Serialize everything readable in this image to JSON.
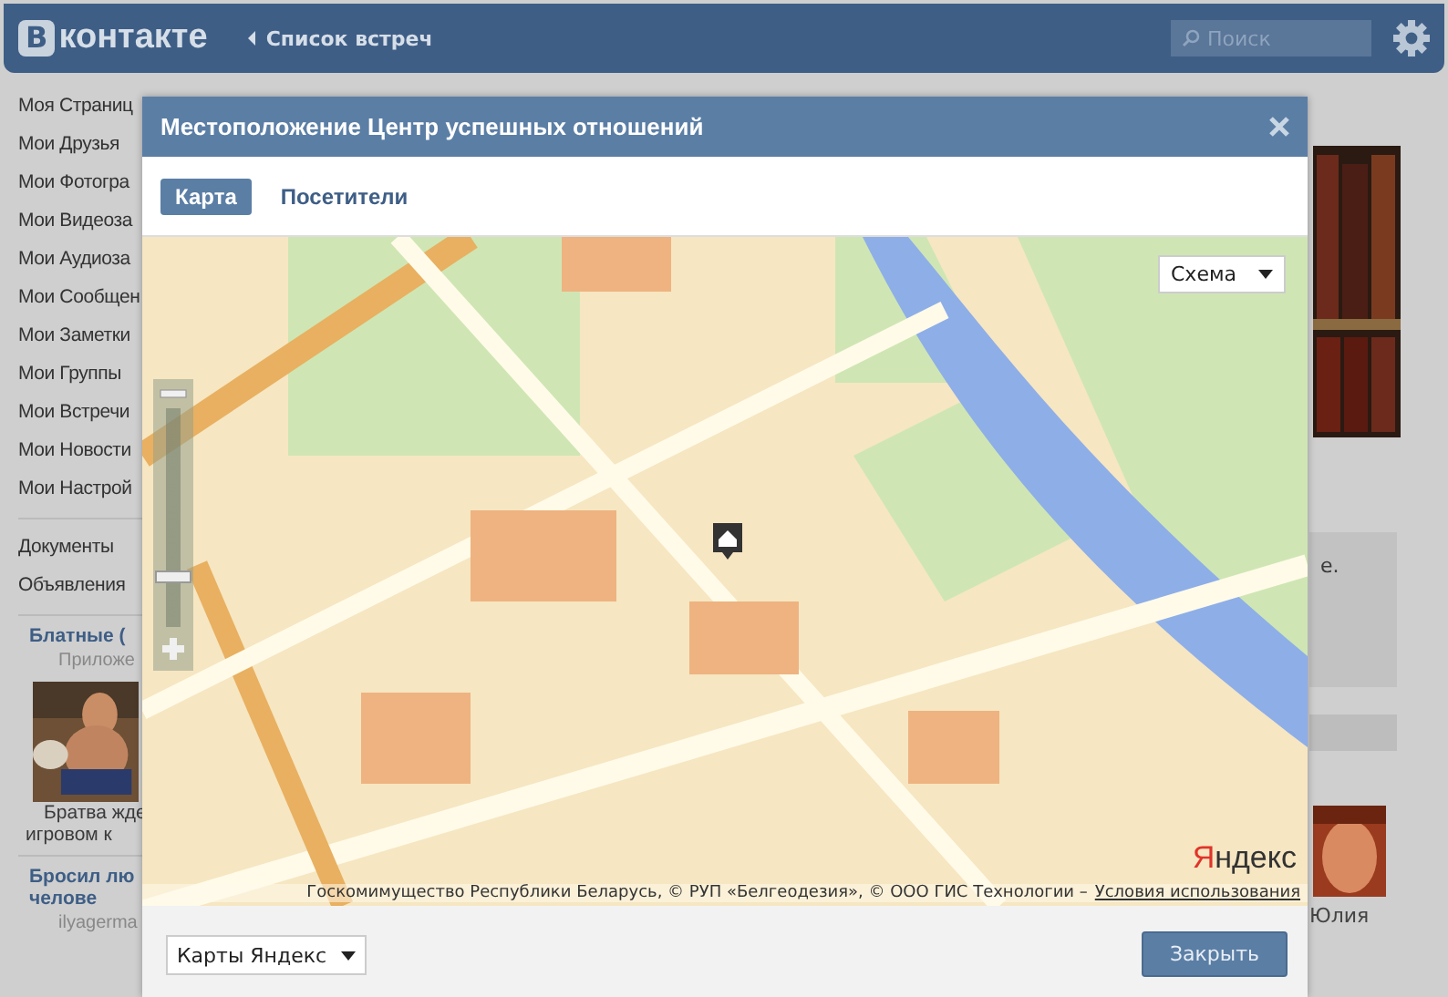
{
  "header": {
    "logo_letter": "В",
    "logo_text": "контакте",
    "back_link": "Список встреч",
    "search": {
      "placeholder": "Поиск"
    }
  },
  "sidebar": {
    "items": [
      "Моя Страниц",
      "Мои Друзья",
      "Мои Фотогра",
      "Мои Видеоза",
      "Мои Аудиоза",
      "Мои Сообщен",
      "Мои Заметки",
      "Мои Группы",
      "Мои Встречи",
      "Мои Новости",
      "Мои Настрой"
    ],
    "extra_items": [
      "Документы",
      "Объявления"
    ]
  },
  "ads": [
    {
      "title": [
        "Блатные ("
      ],
      "subtitle": "Приложе",
      "caption": [
        "Братва жде",
        "игровом к"
      ]
    },
    {
      "title": [
        "Бросил лю",
        "челове"
      ],
      "subtitle": "ilyagerma"
    }
  ],
  "right_column": {
    "text": "е.",
    "name": "Юлия"
  },
  "modal": {
    "title": "Местоположение Центр успешных отношений",
    "tabs": [
      {
        "label": "Карта",
        "selected": true
      },
      {
        "label": "Посетители",
        "selected": false
      }
    ],
    "map": {
      "kind": "picture",
      "layer_select": "Схема",
      "zoom": {
        "level": 0.2
      },
      "logo": [
        "Я",
        "ндекс"
      ],
      "copyright": "Госкомимущество Республики Беларусь, © РУП «Белгеодезия», © ООО ГИС Технологии –",
      "terms_link": "Условия использования"
    },
    "provider_select": "Карты Яндекс",
    "close_button": "Закрыть"
  }
}
